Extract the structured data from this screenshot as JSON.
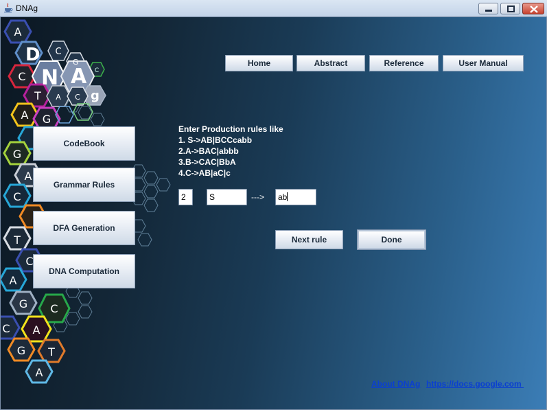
{
  "window": {
    "title": "DNAg",
    "controls": [
      "minimize",
      "maximize",
      "close"
    ]
  },
  "logo_letters": [
    "D",
    "N",
    "A",
    "g"
  ],
  "top_nav": [
    {
      "label": "Home"
    },
    {
      "label": "Abstract"
    },
    {
      "label": "Reference"
    },
    {
      "label": "User Manual"
    }
  ],
  "sidebar": [
    {
      "label": "CodeBook"
    },
    {
      "label": "Grammar Rules"
    },
    {
      "label": "DFA Generation"
    },
    {
      "label": "DNA Computation"
    }
  ],
  "instructions": {
    "heading": "Enter Production rules like",
    "examples": [
      "1. S->AB|BCCcabb",
      "2.A->BAC|abbb",
      "3.B->CAC|BbA",
      "4.C->AB|aC|c"
    ]
  },
  "rule_form": {
    "rule_number": "2",
    "left_side": "S",
    "arrow": "--->",
    "right_side": "ab"
  },
  "actions": {
    "next_rule": "Next rule",
    "done": "Done"
  },
  "footer_links": {
    "about": "About DNAg",
    "docs": "https://docs.google.com "
  },
  "colors": {
    "link": "#0b3fd0",
    "background_dark": "#0b1722",
    "background_light": "#3b7db6"
  }
}
